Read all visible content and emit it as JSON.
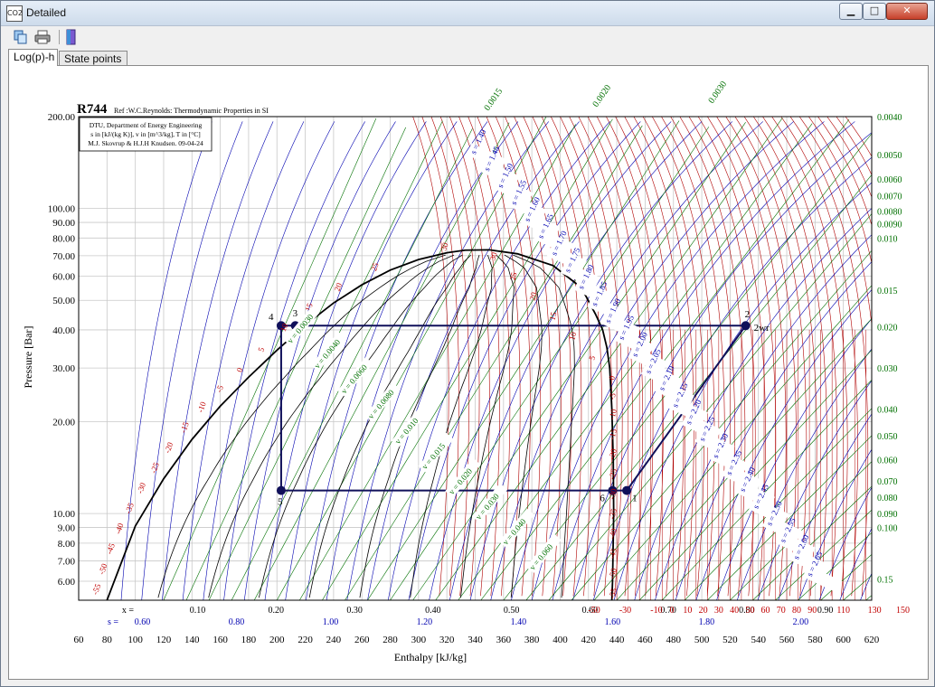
{
  "window": {
    "app_icon_text": "CO2",
    "title": "Detailed",
    "min_glyph": "▁",
    "max_glyph": "□",
    "close_glyph": "✕"
  },
  "toolbar": {
    "icons": [
      "copy-icon",
      "print-icon",
      "exit-door-icon"
    ]
  },
  "tabs": [
    {
      "label": "Log(p)-h",
      "active": true
    },
    {
      "label": "State points",
      "active": false
    }
  ],
  "chart": {
    "refrigerant": "R744",
    "reference": "Ref :W.C.Reynolds: Thermodynamic Properties in SI",
    "info_lines": [
      "DTU, Department of Energy Engineering",
      "s in [kJ/(kg K)], v in [m^3/kg], T in [°C]",
      "M.J. Skovrup & H.J.H Knudsen. 09-04-24"
    ],
    "x_label": "Enthalpy [kJ/kg]",
    "y_label": "Pressure [Bar]",
    "quality_prefix": "x = ",
    "entropy_prefix": "s = ",
    "colors": {
      "isotherm": "#b00000",
      "isochore": "#007000",
      "isentrope": "#0000b0",
      "cycle": "#10105a",
      "grid": "#c8c8c8"
    }
  },
  "chart_data": {
    "type": "line",
    "x_scale": "linear",
    "y_scale": "log",
    "xlim": [
      60,
      620
    ],
    "ylim": [
      5.2,
      200
    ],
    "x_ticks": [
      "60",
      "80",
      "100",
      "120",
      "140",
      "160",
      "180",
      "200",
      "220",
      "240",
      "260",
      "280",
      "300",
      "320",
      "340",
      "360",
      "380",
      "400",
      "420",
      "440",
      "460",
      "480",
      "500",
      "520",
      "540",
      "560",
      "580",
      "600",
      "620"
    ],
    "y_ticks": [
      "6.00",
      "7.00",
      "8.00",
      "9.00",
      "10.00",
      "20.00",
      "30.00",
      "40.00",
      "50.00",
      "60.00",
      "70.00",
      "80.00",
      "90.00",
      "100.00",
      "200.00"
    ],
    "quality_ticks": [
      "0.10",
      "0.20",
      "0.30",
      "0.40",
      "0.50",
      "0.60",
      "0.70",
      "0.80",
      "0.90"
    ],
    "entropy_ticks": [
      "0.60",
      "0.80",
      "1.00",
      "1.20",
      "1.40",
      "1.60",
      "1.80",
      "2.00"
    ],
    "temperature_ticks_bottom": [
      "-50",
      "-30",
      "-10",
      "0",
      "10",
      "20",
      "30",
      "40",
      "50",
      "60",
      "70",
      "80",
      "90",
      "110",
      "130",
      "150"
    ],
    "isochore_labels_right": [
      "0.0040",
      "0.0050",
      "0.0060",
      "0.0070",
      "0.0080",
      "0.0090",
      "0.010",
      "0.015",
      "0.020",
      "0.030",
      "0.040",
      "0.050",
      "0.060",
      "0.070",
      "0.080",
      "0.090",
      "0.100",
      "0.15"
    ],
    "isochore_labels_top": [
      "0.0015",
      "0.0020",
      "0.0030"
    ],
    "isotherm_labels_liquid": [
      "-55",
      "-50",
      "-45",
      "-40",
      "-35",
      "-30",
      "-25",
      "-20",
      "-15",
      "-10",
      "-5",
      "0",
      "5",
      "10",
      "15",
      "20",
      "25",
      "30"
    ],
    "isotherm_labels_vapor": [
      "30",
      "25",
      "20",
      "15",
      "10",
      "5",
      "0",
      "-5",
      "-10",
      "-15",
      "-20",
      "-25",
      "-30",
      "-35",
      "-40",
      "-45",
      "-50",
      "-55"
    ],
    "isentrope_labels": [
      "s = 1.40",
      "s = 1.45",
      "s = 1.50",
      "s = 1.55",
      "s = 1.60",
      "s = 1.65",
      "s = 1.70",
      "s = 1.75",
      "s = 1.80",
      "s = 1.85",
      "s = 1.90",
      "s = 1.95",
      "s = 2.00",
      "s = 2.05",
      "s = 2.10",
      "s = 2.15",
      "s = 2.20",
      "s = 2.25",
      "s = 2.30",
      "s = 2.35",
      "s = 2.40",
      "s = 2.45",
      "s = 2.50",
      "s = 2.55",
      "s = 2.60",
      "s = 2.65"
    ],
    "isochore_labels_inside": [
      "v = 0.0030",
      "v = 0.0040",
      "v = 0.0060",
      "v = 0.0080",
      "v = 0.010",
      "v = 0.015",
      "v = 0.020",
      "v = 0.030",
      "v = 0.040",
      "v = 0.060"
    ],
    "saturation_dome": {
      "liquid": [
        [
          80,
          5.2
        ],
        [
          100,
          9.1
        ],
        [
          120,
          13.0
        ],
        [
          140,
          17.5
        ],
        [
          160,
          22.5
        ],
        [
          180,
          28.0
        ],
        [
          200,
          34.3
        ],
        [
          220,
          41.5
        ],
        [
          240,
          49.0
        ],
        [
          260,
          56.2
        ],
        [
          280,
          62.8
        ],
        [
          300,
          68.0
        ],
        [
          320,
          71.6
        ],
        [
          333,
          73.0
        ]
      ],
      "vapor": [
        [
          333,
          73.0
        ],
        [
          350,
          73.2
        ],
        [
          370,
          71.0
        ],
        [
          395,
          65.0
        ],
        [
          415,
          55.0
        ],
        [
          425,
          45.0
        ],
        [
          430,
          40.0
        ],
        [
          433,
          35.0
        ],
        [
          435,
          30.0
        ],
        [
          436.5,
          22.0
        ],
        [
          437.5,
          15.0
        ],
        [
          437.8,
          10.0
        ],
        [
          437,
          6.0
        ],
        [
          436.5,
          5.2
        ]
      ]
    },
    "cycle": {
      "points": [
        {
          "label": "1",
          "h": 447,
          "p": 11.9
        },
        {
          "label": "2",
          "h": 531,
          "p": 41.3
        },
        {
          "label": "2wr",
          "h": 531,
          "p": 41.3
        },
        {
          "label": "3",
          "h": 213,
          "p": 41.3
        },
        {
          "label": "4",
          "h": 203,
          "p": 41.3
        },
        {
          "label": "5",
          "h": 203,
          "p": 11.9
        },
        {
          "label": "6",
          "h": 437,
          "p": 11.9
        }
      ],
      "path": [
        [
          447,
          11.9
        ],
        [
          531,
          41.3
        ],
        [
          213,
          41.3
        ],
        [
          203,
          41.3
        ],
        [
          203,
          11.9
        ],
        [
          437,
          11.9
        ],
        [
          447,
          11.9
        ]
      ]
    }
  }
}
